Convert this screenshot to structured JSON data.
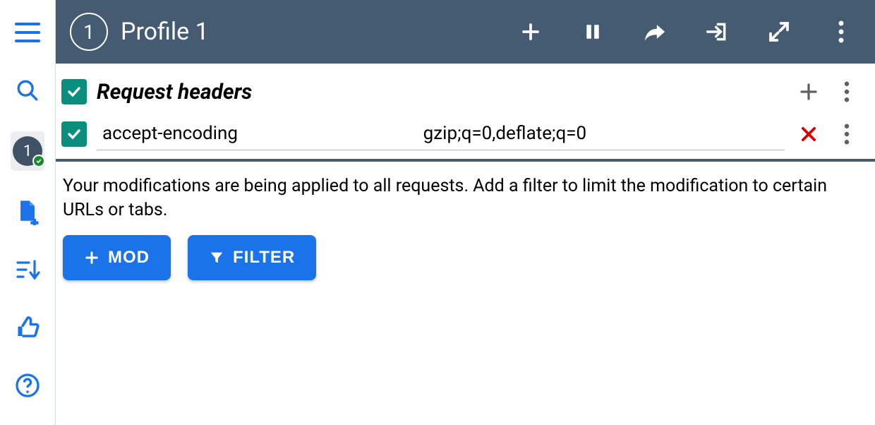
{
  "appbar": {
    "profile_number": "1",
    "title": "Profile 1"
  },
  "sidebar": {
    "profile_badge": "1"
  },
  "section": {
    "title": "Request headers"
  },
  "headers": [
    {
      "enabled": true,
      "name": "accept-encoding",
      "value": "gzip;q=0,deflate;q=0"
    }
  ],
  "info": {
    "text": "Your modifications are being applied to all requests. Add a filter to limit the modification to certain URLs or tabs.",
    "mod_label": "MOD",
    "filter_label": "FILTER"
  }
}
